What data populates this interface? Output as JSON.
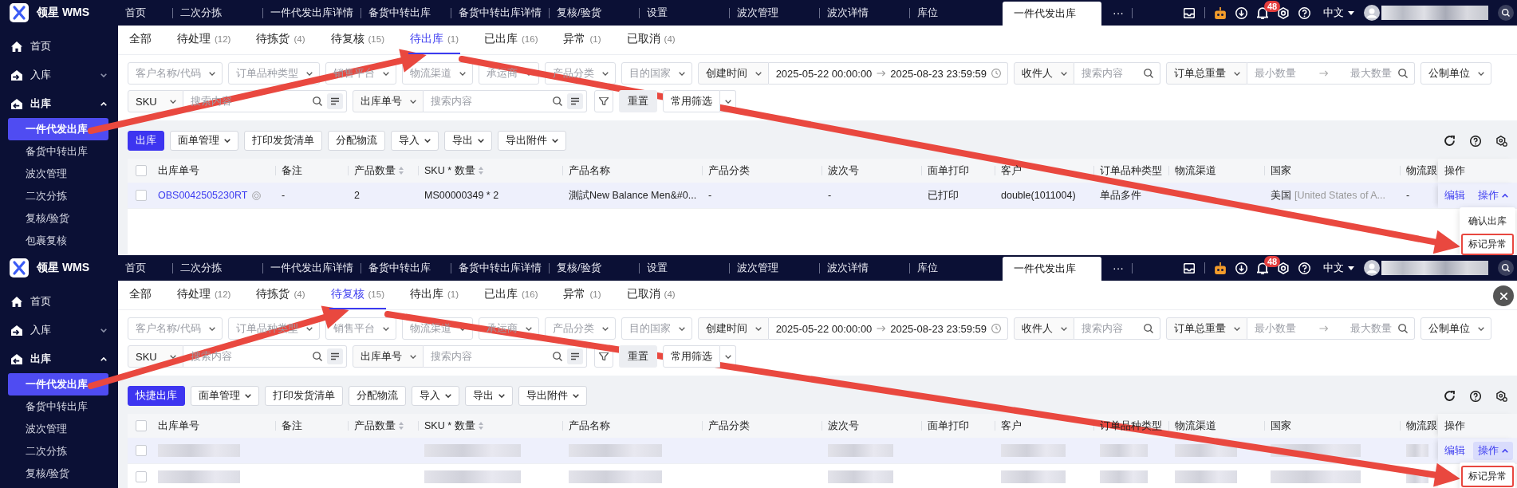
{
  "panels": [
    {
      "brand": "领星 WMS",
      "nav_tabs": [
        {
          "label": "首页",
          "selected": false
        },
        {
          "label": "二次分拣",
          "selected": false
        },
        {
          "label": "一件代发出库详情",
          "selected": false
        },
        {
          "label": "备货中转出库",
          "selected": false
        },
        {
          "label": "备货中转出库详情",
          "selected": false
        },
        {
          "label": "复核/验货",
          "selected": false
        },
        {
          "label": "设置",
          "selected": false
        },
        {
          "label": "波次管理",
          "selected": false
        },
        {
          "label": "波次详情",
          "selected": false
        },
        {
          "label": "库位",
          "selected": false
        },
        {
          "label": "一件代发出库",
          "selected": true
        }
      ],
      "more": "···",
      "notification_count": "48",
      "language": "中文",
      "show_close": false,
      "sidebar": [
        {
          "label": "首页",
          "kind": "home"
        },
        {
          "label": "入库",
          "kind": "inbound",
          "expanded": false
        },
        {
          "label": "出库",
          "kind": "outbound",
          "expanded": true,
          "children": [
            {
              "label": "一件代发出库",
              "selected": true
            },
            {
              "label": "备货中转出库",
              "selected": false
            },
            {
              "label": "波次管理",
              "selected": false
            },
            {
              "label": "二次分拣",
              "selected": false
            },
            {
              "label": "复核/验货",
              "selected": false
            },
            {
              "label": "包裹复核",
              "selected": false
            }
          ]
        }
      ],
      "status_tabs": [
        {
          "label": "全部",
          "selected": false
        },
        {
          "label": "待处理",
          "count": "(12)",
          "selected": false
        },
        {
          "label": "待拣货",
          "count": "(4)",
          "selected": false
        },
        {
          "label": "待复核",
          "count": "(15)",
          "selected": false
        },
        {
          "label": "待出库",
          "count": "(1)",
          "selected": true
        },
        {
          "label": "已出库",
          "count": "(16)",
          "selected": false
        },
        {
          "label": "异常",
          "count": "(1)",
          "selected": false
        },
        {
          "label": "已取消",
          "count": "(4)",
          "selected": false
        }
      ],
      "filter_rows": [
        [
          {
            "kind": "select",
            "placeholder": "客户名称/代码"
          },
          {
            "kind": "select",
            "placeholder": "订单品种类型"
          },
          {
            "kind": "select",
            "placeholder": "销售平台"
          },
          {
            "kind": "select",
            "placeholder": "物流渠道"
          },
          {
            "kind": "select",
            "placeholder": "承运商"
          },
          {
            "kind": "select",
            "placeholder": "产品分类"
          },
          {
            "kind": "select",
            "placeholder": "目的国家"
          },
          {
            "kind": "combo",
            "label": "创建时间",
            "field": {
              "kind": "date_range",
              "start": "2025-05-22 00:00:00",
              "end": "2025-08-23 23:59:59"
            }
          },
          {
            "kind": "combo",
            "label": "收件人",
            "field": {
              "kind": "search",
              "placeholder": "搜索内容"
            }
          },
          {
            "kind": "combo",
            "label": "订单总重量",
            "field": {
              "kind": "range",
              "min_placeholder": "最小数量",
              "max_placeholder": "最大数量"
            }
          },
          {
            "kind": "select",
            "value": "公制单位"
          }
        ],
        [
          {
            "kind": "combo",
            "label": "SKU",
            "field": {
              "kind": "search_list",
              "placeholder": "搜索内容"
            }
          },
          {
            "kind": "combo",
            "label": "出库单号",
            "field": {
              "kind": "search_list",
              "placeholder": "搜索内容"
            }
          },
          {
            "kind": "icon_button"
          },
          {
            "kind": "button",
            "label": "重置"
          },
          {
            "kind": "split_button",
            "label": "常用筛选"
          }
        ]
      ],
      "actions": [
        {
          "label": "出库",
          "kind": "primary"
        },
        {
          "label": "面单管理",
          "kind": "dropdown"
        },
        {
          "label": "打印发货清单",
          "kind": "plain"
        },
        {
          "label": "分配物流",
          "kind": "plain"
        },
        {
          "label": "导入",
          "kind": "dropdown"
        },
        {
          "label": "导出",
          "kind": "dropdown"
        },
        {
          "label": "导出附件",
          "kind": "dropdown"
        }
      ],
      "table": {
        "all_checked": false,
        "columns": [
          {
            "label": "出库单号"
          },
          {
            "label": "备注"
          },
          {
            "label": "产品数量",
            "sortable": true
          },
          {
            "label": "SKU * 数量",
            "sortable": true
          },
          {
            "label": "产品名称"
          },
          {
            "label": "产品分类"
          },
          {
            "label": "波次号"
          },
          {
            "label": "面单打印"
          },
          {
            "label": "客户"
          },
          {
            "label": "订单品种类型"
          },
          {
            "label": "物流渠道"
          },
          {
            "label": "国家"
          },
          {
            "label": "物流跟"
          }
        ],
        "actions_column": "操作",
        "rows": [
          {
            "kind": "data",
            "checked": false,
            "highlighted": true,
            "cells": [
              {
                "kind": "link",
                "text": "OBS0042505230RT"
              },
              {
                "kind": "text",
                "text": "-"
              },
              {
                "kind": "text",
                "text": "2"
              },
              {
                "kind": "text",
                "text": "MS00000349 * 2"
              },
              {
                "kind": "text",
                "text": "測試New Balance Men&#0..."
              },
              {
                "kind": "text",
                "text": "-"
              },
              {
                "kind": "text",
                "text": "-"
              },
              {
                "kind": "text",
                "text": "已打印"
              },
              {
                "kind": "text",
                "text": "double(1011004)"
              },
              {
                "kind": "text",
                "text": "单品多件"
              },
              {
                "kind": "blank"
              },
              {
                "kind": "country",
                "text": "美国",
                "sub": "[United States of A..."
              },
              {
                "kind": "text",
                "text": "-"
              }
            ],
            "edit": "编辑",
            "menu_label": "操作",
            "menu_open": true,
            "pressed": false,
            "menu": [
              {
                "label": "确认出库",
                "highlighted": false
              },
              {
                "label": "标记异常",
                "highlighted": true
              }
            ]
          }
        ]
      },
      "annotations": [
        {
          "kind": "arrow"
        },
        {
          "kind": "arrow"
        }
      ]
    },
    {
      "brand": "领星 WMS",
      "nav_tabs": [
        {
          "label": "首页",
          "selected": false
        },
        {
          "label": "二次分拣",
          "selected": false
        },
        {
          "label": "一件代发出库详情",
          "selected": false
        },
        {
          "label": "备货中转出库",
          "selected": false
        },
        {
          "label": "备货中转出库详情",
          "selected": false
        },
        {
          "label": "复核/验货",
          "selected": false
        },
        {
          "label": "设置",
          "selected": false
        },
        {
          "label": "波次管理",
          "selected": false
        },
        {
          "label": "波次详情",
          "selected": false
        },
        {
          "label": "库位",
          "selected": false
        },
        {
          "label": "一件代发出库",
          "selected": true
        }
      ],
      "more": "···",
      "notification_count": "48",
      "language": "中文",
      "show_close": true,
      "sidebar": [
        {
          "label": "首页",
          "kind": "home"
        },
        {
          "label": "入库",
          "kind": "inbound",
          "expanded": false
        },
        {
          "label": "出库",
          "kind": "outbound",
          "expanded": true,
          "children": [
            {
              "label": "一件代发出库",
              "selected": true
            },
            {
              "label": "备货中转出库",
              "selected": false
            },
            {
              "label": "波次管理",
              "selected": false
            },
            {
              "label": "二次分拣",
              "selected": false
            },
            {
              "label": "复核/验货",
              "selected": false
            }
          ]
        }
      ],
      "status_tabs": [
        {
          "label": "全部",
          "selected": false
        },
        {
          "label": "待处理",
          "count": "(12)",
          "selected": false
        },
        {
          "label": "待拣货",
          "count": "(4)",
          "selected": false
        },
        {
          "label": "待复核",
          "count": "(15)",
          "selected": true
        },
        {
          "label": "待出库",
          "count": "(1)",
          "selected": false
        },
        {
          "label": "已出库",
          "count": "(16)",
          "selected": false
        },
        {
          "label": "异常",
          "count": "(1)",
          "selected": false
        },
        {
          "label": "已取消",
          "count": "(4)",
          "selected": false
        }
      ],
      "filter_rows": [
        [
          {
            "kind": "select",
            "placeholder": "客户名称/代码"
          },
          {
            "kind": "select",
            "placeholder": "订单品种类型"
          },
          {
            "kind": "select",
            "placeholder": "销售平台"
          },
          {
            "kind": "select",
            "placeholder": "物流渠道"
          },
          {
            "kind": "select",
            "placeholder": "承运商"
          },
          {
            "kind": "select",
            "placeholder": "产品分类"
          },
          {
            "kind": "select",
            "placeholder": "目的国家"
          },
          {
            "kind": "combo",
            "label": "创建时间",
            "field": {
              "kind": "date_range",
              "start": "2025-05-22 00:00:00",
              "end": "2025-08-23 23:59:59"
            }
          },
          {
            "kind": "combo",
            "label": "收件人",
            "field": {
              "kind": "search",
              "placeholder": "搜索内容"
            }
          },
          {
            "kind": "combo",
            "label": "订单总重量",
            "field": {
              "kind": "range",
              "min_placeholder": "最小数量",
              "max_placeholder": "最大数量"
            }
          },
          {
            "kind": "select",
            "value": "公制单位"
          }
        ],
        [
          {
            "kind": "combo",
            "label": "SKU",
            "field": {
              "kind": "search_list",
              "placeholder": "搜索内容"
            }
          },
          {
            "kind": "combo",
            "label": "出库单号",
            "field": {
              "kind": "search_list",
              "placeholder": "搜索内容"
            }
          },
          {
            "kind": "icon_button"
          },
          {
            "kind": "button",
            "label": "重置"
          },
          {
            "kind": "split_button",
            "label": "常用筛选"
          }
        ]
      ],
      "actions": [
        {
          "label": "快捷出库",
          "kind": "primary"
        },
        {
          "label": "面单管理",
          "kind": "dropdown"
        },
        {
          "label": "打印发货清单",
          "kind": "plain"
        },
        {
          "label": "分配物流",
          "kind": "plain"
        },
        {
          "label": "导入",
          "kind": "dropdown"
        },
        {
          "label": "导出",
          "kind": "dropdown"
        },
        {
          "label": "导出附件",
          "kind": "dropdown"
        }
      ],
      "table": {
        "all_checked": false,
        "columns": [
          {
            "label": "出库单号"
          },
          {
            "label": "备注"
          },
          {
            "label": "产品数量",
            "sortable": true
          },
          {
            "label": "SKU * 数量",
            "sortable": true
          },
          {
            "label": "产品名称"
          },
          {
            "label": "产品分类"
          },
          {
            "label": "波次号"
          },
          {
            "label": "面单打印"
          },
          {
            "label": "客户"
          },
          {
            "label": "订单品种类型"
          },
          {
            "label": "物流渠道"
          },
          {
            "label": "国家"
          },
          {
            "label": "物流跟"
          }
        ],
        "actions_column": "操作",
        "rows": [
          {
            "kind": "blurred",
            "checked": false,
            "highlighted": true,
            "edit": "编辑",
            "menu_label": "操作",
            "menu_open": true,
            "pressed": true,
            "menu": [
              {
                "label": "标记异常",
                "highlighted": true
              }
            ]
          },
          {
            "kind": "blurred",
            "checked": false,
            "highlighted": false
          }
        ]
      },
      "annotations": [
        {
          "kind": "arrow"
        },
        {
          "kind": "arrow"
        }
      ]
    }
  ]
}
